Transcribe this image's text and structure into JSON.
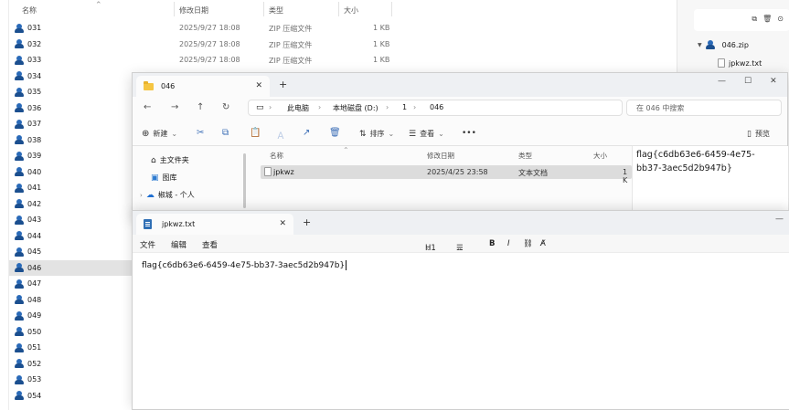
{
  "bg_explorer": {
    "headers": {
      "name": "名称",
      "date": "修改日期",
      "type": "类型",
      "size": "大小"
    },
    "rows": [
      {
        "name": "031",
        "date": "2025/9/27 18:08",
        "type": "ZIP 压缩文件",
        "size": "1 KB"
      },
      {
        "name": "032",
        "date": "2025/9/27 18:08",
        "type": "ZIP 压缩文件",
        "size": "1 KB"
      },
      {
        "name": "033",
        "date": "2025/9/27 18:08",
        "type": "ZIP 压缩文件",
        "size": "1 KB"
      }
    ],
    "left_items": [
      "031",
      "032",
      "033",
      "034",
      "035",
      "036",
      "037",
      "038",
      "039",
      "040",
      "041",
      "042",
      "043",
      "044",
      "045",
      "046",
      "047",
      "048",
      "049",
      "050",
      "051",
      "052",
      "053",
      "054"
    ],
    "selected_item": "046",
    "right_panel": {
      "tree_folder": "046.zip",
      "tree_file": "jpkwz.txt"
    }
  },
  "explorer": {
    "tab_title": "046",
    "breadcrumb": [
      "此电脑",
      "本地磁盘 (D:)",
      "1",
      "046"
    ],
    "search_placeholder": "在 046 中搜索",
    "toolbar": {
      "new": "新建",
      "sort": "排序",
      "view": "查看",
      "more": "•••",
      "preview": "预览"
    },
    "nav": {
      "home": "主文件夹",
      "gallery": "图库",
      "onedrive": "椒城 - 个人"
    },
    "list_headers": {
      "name": "名称",
      "date": "修改日期",
      "type": "类型",
      "size": "大小"
    },
    "file": {
      "name": "jpkwz",
      "date": "2025/4/25 23:58",
      "type": "文本文档",
      "size": "1 K"
    },
    "preview_text_line1": "flag{c6db63e6-6459-4e75-",
    "preview_text_line2": "bb37-3aec5d2b947b}"
  },
  "notepad": {
    "tab_title": "jpkwz.txt",
    "menu": {
      "file": "文件",
      "edit": "编辑",
      "view": "查看"
    },
    "format": {
      "heading": "H1",
      "bold": "B",
      "italic": "I"
    },
    "content": "flag{c6db63e6-6459-4e75-bb37-3aec5d2b947b}"
  }
}
